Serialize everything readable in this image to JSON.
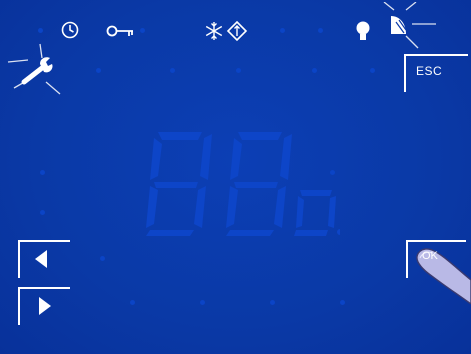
{
  "status_bar": {
    "icons": [
      "clock-icon",
      "key-icon",
      "snowflake-icon",
      "defrost-icon",
      "lightbulb-icon",
      "fan-icon"
    ]
  },
  "tools": {
    "icon": "wrench-icon",
    "state": "flashing"
  },
  "buttons": {
    "esc_label": "ESC",
    "ok_label": "OK"
  },
  "display": {
    "digits": "88.8",
    "state": "dimmed"
  },
  "colors": {
    "background": "#0a3aa8",
    "foreground": "#ffffff",
    "ghost_segment": "#0d45c8",
    "finger": "#b9b9e6"
  }
}
